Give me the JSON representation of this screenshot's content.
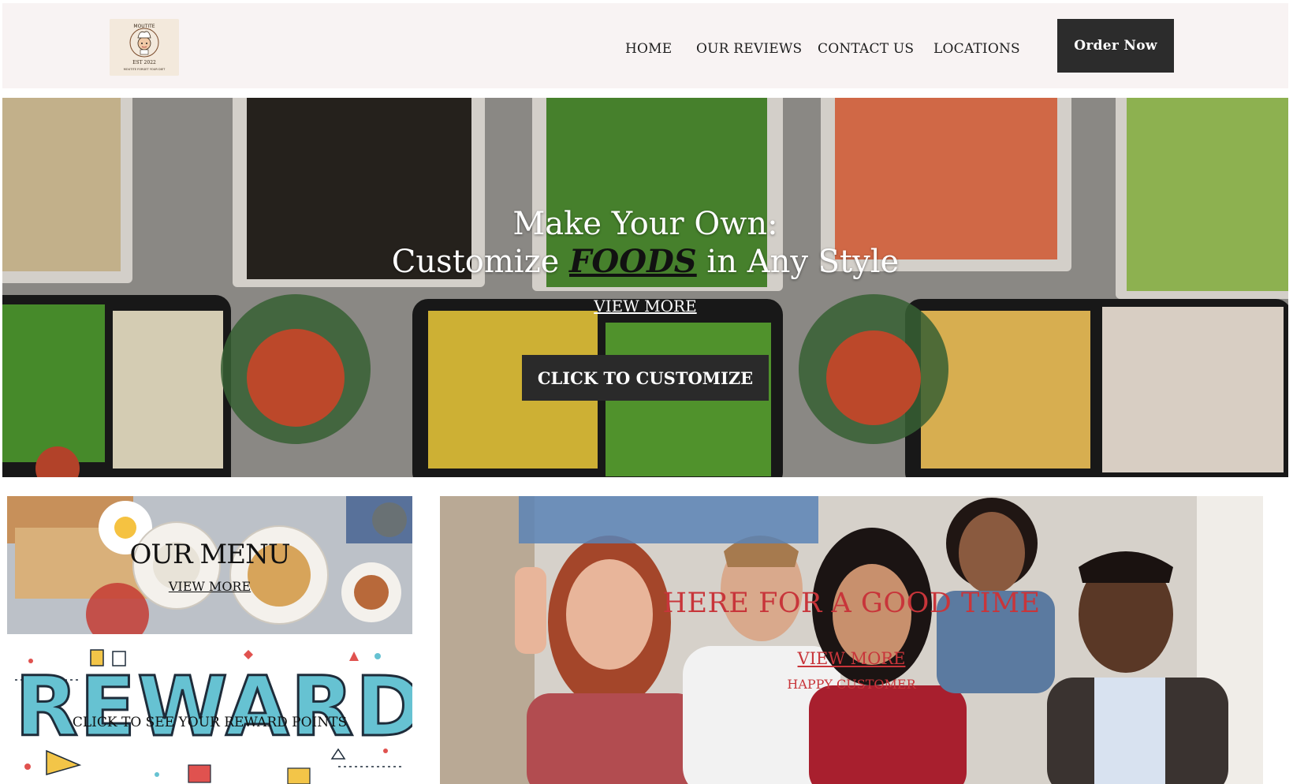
{
  "header": {
    "logo": {
      "brand_arc": "MOUTITE",
      "est": "EST 2022",
      "tagline": "MOUTITE FORGET YOUR DIET",
      "icon": "chef-mascot-icon"
    },
    "nav": [
      {
        "label": "HOME"
      },
      {
        "label": "OUR REVIEWS"
      },
      {
        "label": "CONTACT US"
      },
      {
        "label": "LOCATIONS"
      }
    ],
    "order_button": "Order Now"
  },
  "hero": {
    "line1": "Make Your Own:",
    "line2_before": "Customize ",
    "line2_emphasis": "FOODS",
    "line2_after": " in Any Style",
    "view_more": "VIEW MORE",
    "cta": "CLICK TO CUSTOMIZE"
  },
  "menu_tile": {
    "title": "OUR MENU",
    "view_more": "VIEW MORE"
  },
  "reward_tile": {
    "graphic_word": "REWARD",
    "cta": "CLICK TO SEE YOUR REWARD POINTS"
  },
  "people_tile": {
    "title": "HERE FOR A GOOD TIME",
    "view_more": "VIEW MORE",
    "subtitle": "HAPPY CUSTOMER"
  },
  "colors": {
    "header_bg": "#f8f3f3",
    "button_dark": "#2c2c2c",
    "accent_red": "#c8353a",
    "reward_blue": "#66c2d2"
  }
}
